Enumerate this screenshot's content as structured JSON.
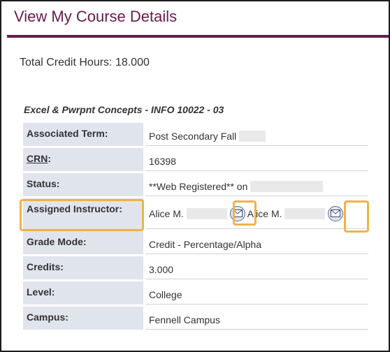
{
  "header": {
    "title": "View My Course Details"
  },
  "summary": {
    "total_credit_hours": "Total Credit Hours: 18.000"
  },
  "course": {
    "title": "Excel & Pwrpnt Concepts - INFO 10022 - 03",
    "rows": [
      {
        "label": "Associated Term:",
        "value": "Post Secondary Fall"
      },
      {
        "label": "CRN",
        "label_suffix": ":",
        "value": "16398"
      },
      {
        "label": "Status:",
        "value": "**Web Registered** on"
      },
      {
        "label": "Assigned Instructor:",
        "instructor_1": "Alice M.",
        "instructor_2": "Alice M."
      },
      {
        "label": "Grade Mode:",
        "value": "Credit - Percentage/Alpha"
      },
      {
        "label": "Credits:",
        "value": "3.000"
      },
      {
        "label": "Level:",
        "value": "College"
      },
      {
        "label": "Campus:",
        "value": "Fennell Campus"
      }
    ]
  },
  "icons": {
    "email": "envelope-icon"
  },
  "colors": {
    "brand": "#6a1a4c",
    "label_bg": "#e0e4ed",
    "highlight": "#f0b24a"
  }
}
